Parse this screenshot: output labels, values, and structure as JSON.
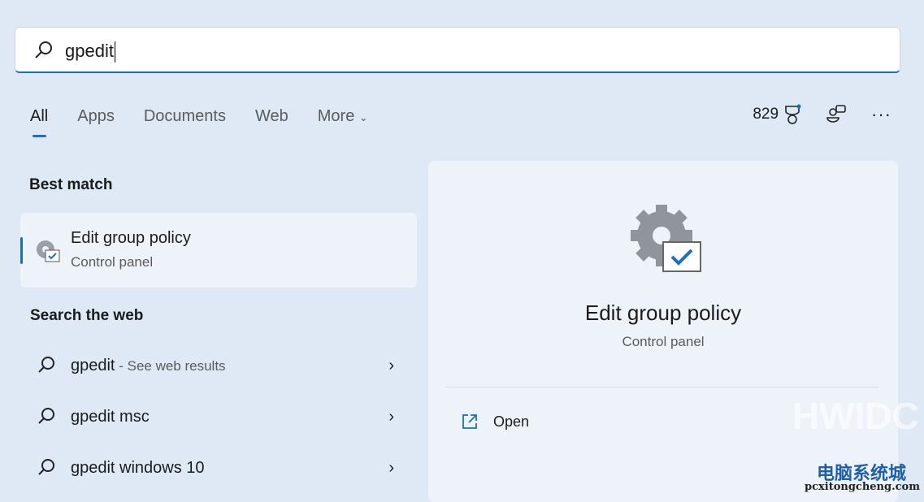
{
  "search": {
    "value": "gpedit"
  },
  "tabs": [
    "All",
    "Apps",
    "Documents",
    "Web",
    "More"
  ],
  "toolbar": {
    "points": "829"
  },
  "best_match": {
    "heading": "Best match",
    "title": "Edit group policy",
    "subtitle": "Control panel"
  },
  "web": {
    "heading": "Search the web",
    "items": [
      {
        "query": "gpedit",
        "suffix": " - See web results"
      },
      {
        "query": "gpedit msc",
        "suffix": ""
      },
      {
        "query": "gpedit windows 10",
        "suffix": ""
      }
    ]
  },
  "detail": {
    "title": "Edit group policy",
    "subtitle": "Control panel",
    "open_label": "Open"
  },
  "watermark": {
    "text": "HWIDC",
    "site_cn": "电脑系统城",
    "site_url": "pcxitongcheng.com"
  },
  "colors": {
    "accent": "#1a6fc4"
  }
}
